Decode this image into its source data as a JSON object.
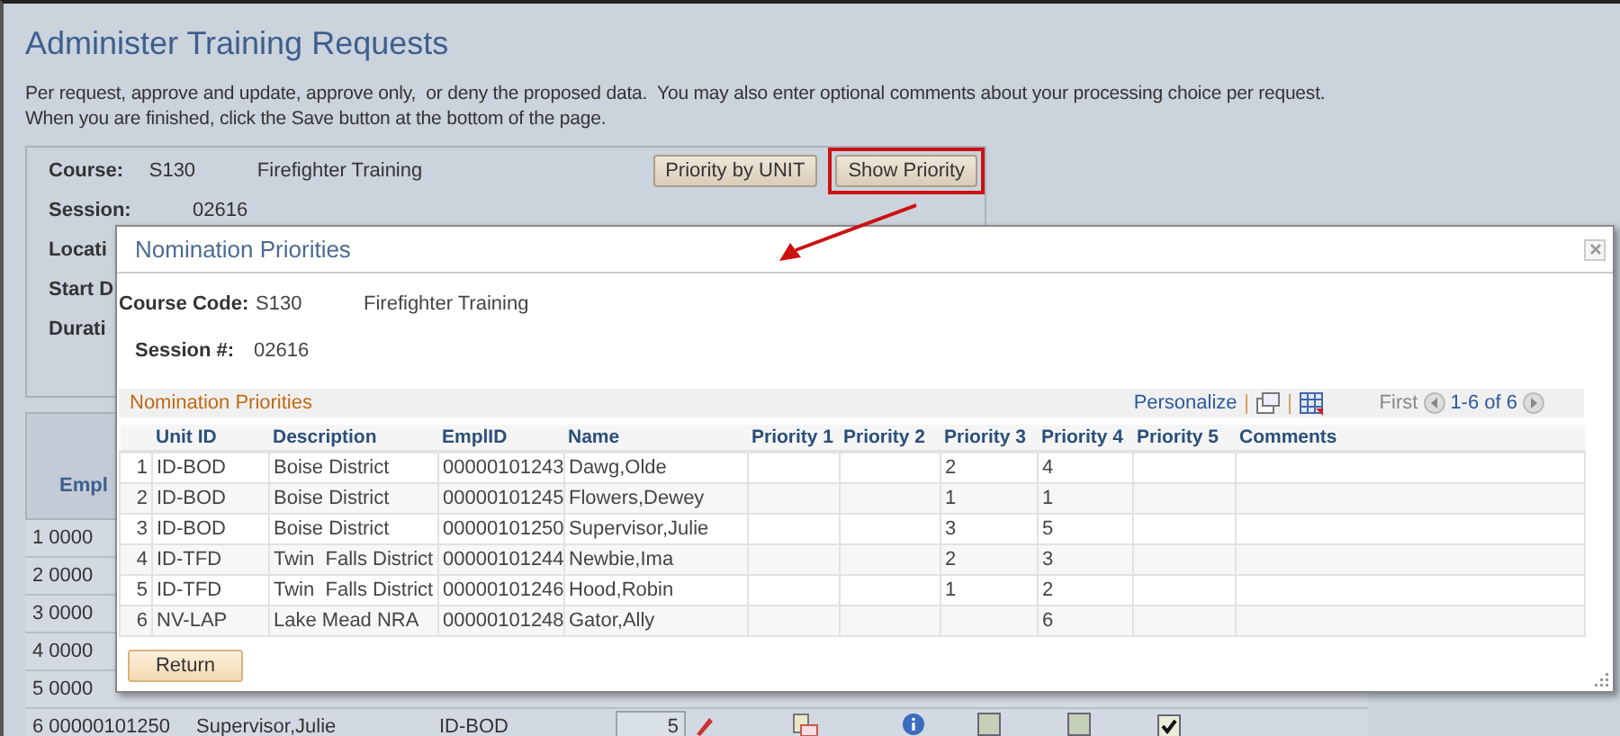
{
  "page": {
    "title": "Administer Training Requests",
    "instructions": "Per request, approve and update, approve only,  or deny the proposed data.  You may also enter optional comments about your processing choice per request.  When you are finished, click the Save button at the bottom of the page.",
    "course": {
      "fields": [
        {
          "label": "Course:",
          "value": "S130",
          "description": "Firefighter Training"
        },
        {
          "label": "Session:",
          "value": "02616"
        },
        {
          "label": "Locati"
        },
        {
          "label": "Start D"
        },
        {
          "label": "Durati"
        }
      ],
      "buttons": [
        {
          "label": "Priority by UNIT",
          "highlighted": false
        },
        {
          "label": "Show Priority",
          "highlighted": true
        }
      ]
    },
    "grid": {
      "header": "Empl",
      "rows": [
        {
          "number": "1",
          "emplid": "0000"
        },
        {
          "number": "2",
          "emplid": "0000"
        },
        {
          "number": "3",
          "emplid": "0000"
        },
        {
          "number": "4",
          "emplid": "0000"
        },
        {
          "number": "5",
          "emplid": "0000"
        },
        {
          "number": "6",
          "emplid": "00000101250",
          "name": "Supervisor,Julie",
          "unit": "ID-BOD",
          "priority": "5",
          "checks": [
            {
              "checked": false
            },
            {
              "checked": false
            },
            {
              "checked": true
            }
          ]
        }
      ]
    }
  },
  "modal": {
    "title": "Nomination Priorities",
    "course_code": {
      "label": "Course Code:",
      "value": "S130",
      "description": "Firefighter Training"
    },
    "session": {
      "label": "Session #:",
      "value": "02616"
    },
    "grid": {
      "title": "Nomination Priorities",
      "personalize": "Personalize",
      "first": "First",
      "range": "1-6 of 6",
      "columns": [
        "Unit ID",
        "Description",
        "EmplID",
        "Name",
        "Priority 1",
        "Priority 2",
        "Priority 3",
        "Priority 4",
        "Priority 5",
        "Comments"
      ],
      "rows": [
        {
          "number": "1",
          "cells": [
            "ID-BOD",
            "Boise District",
            "00000101243",
            "Dawg,Olde",
            "",
            "",
            "2",
            "4",
            "",
            ""
          ]
        },
        {
          "number": "2",
          "cells": [
            "ID-BOD",
            "Boise District",
            "00000101245",
            "Flowers,Dewey",
            "",
            "",
            "1",
            "1",
            "",
            ""
          ]
        },
        {
          "number": "3",
          "cells": [
            "ID-BOD",
            "Boise District",
            "00000101250",
            "Supervisor,Julie",
            "",
            "",
            "3",
            "5",
            "",
            ""
          ]
        },
        {
          "number": "4",
          "cells": [
            "ID-TFD",
            "Twin  Falls District",
            "00000101244",
            "Newbie,Ima",
            "",
            "",
            "2",
            "3",
            "",
            ""
          ]
        },
        {
          "number": "5",
          "cells": [
            "ID-TFD",
            "Twin  Falls District",
            "00000101246",
            "Hood,Robin",
            "",
            "",
            "1",
            "2",
            "",
            ""
          ]
        },
        {
          "number": "6",
          "cells": [
            "NV-LAP",
            "Lake Mead NRA",
            "00000101248",
            "Gator,Ally",
            "",
            "",
            "",
            "6",
            "",
            ""
          ]
        }
      ]
    },
    "return_button": "Return"
  }
}
